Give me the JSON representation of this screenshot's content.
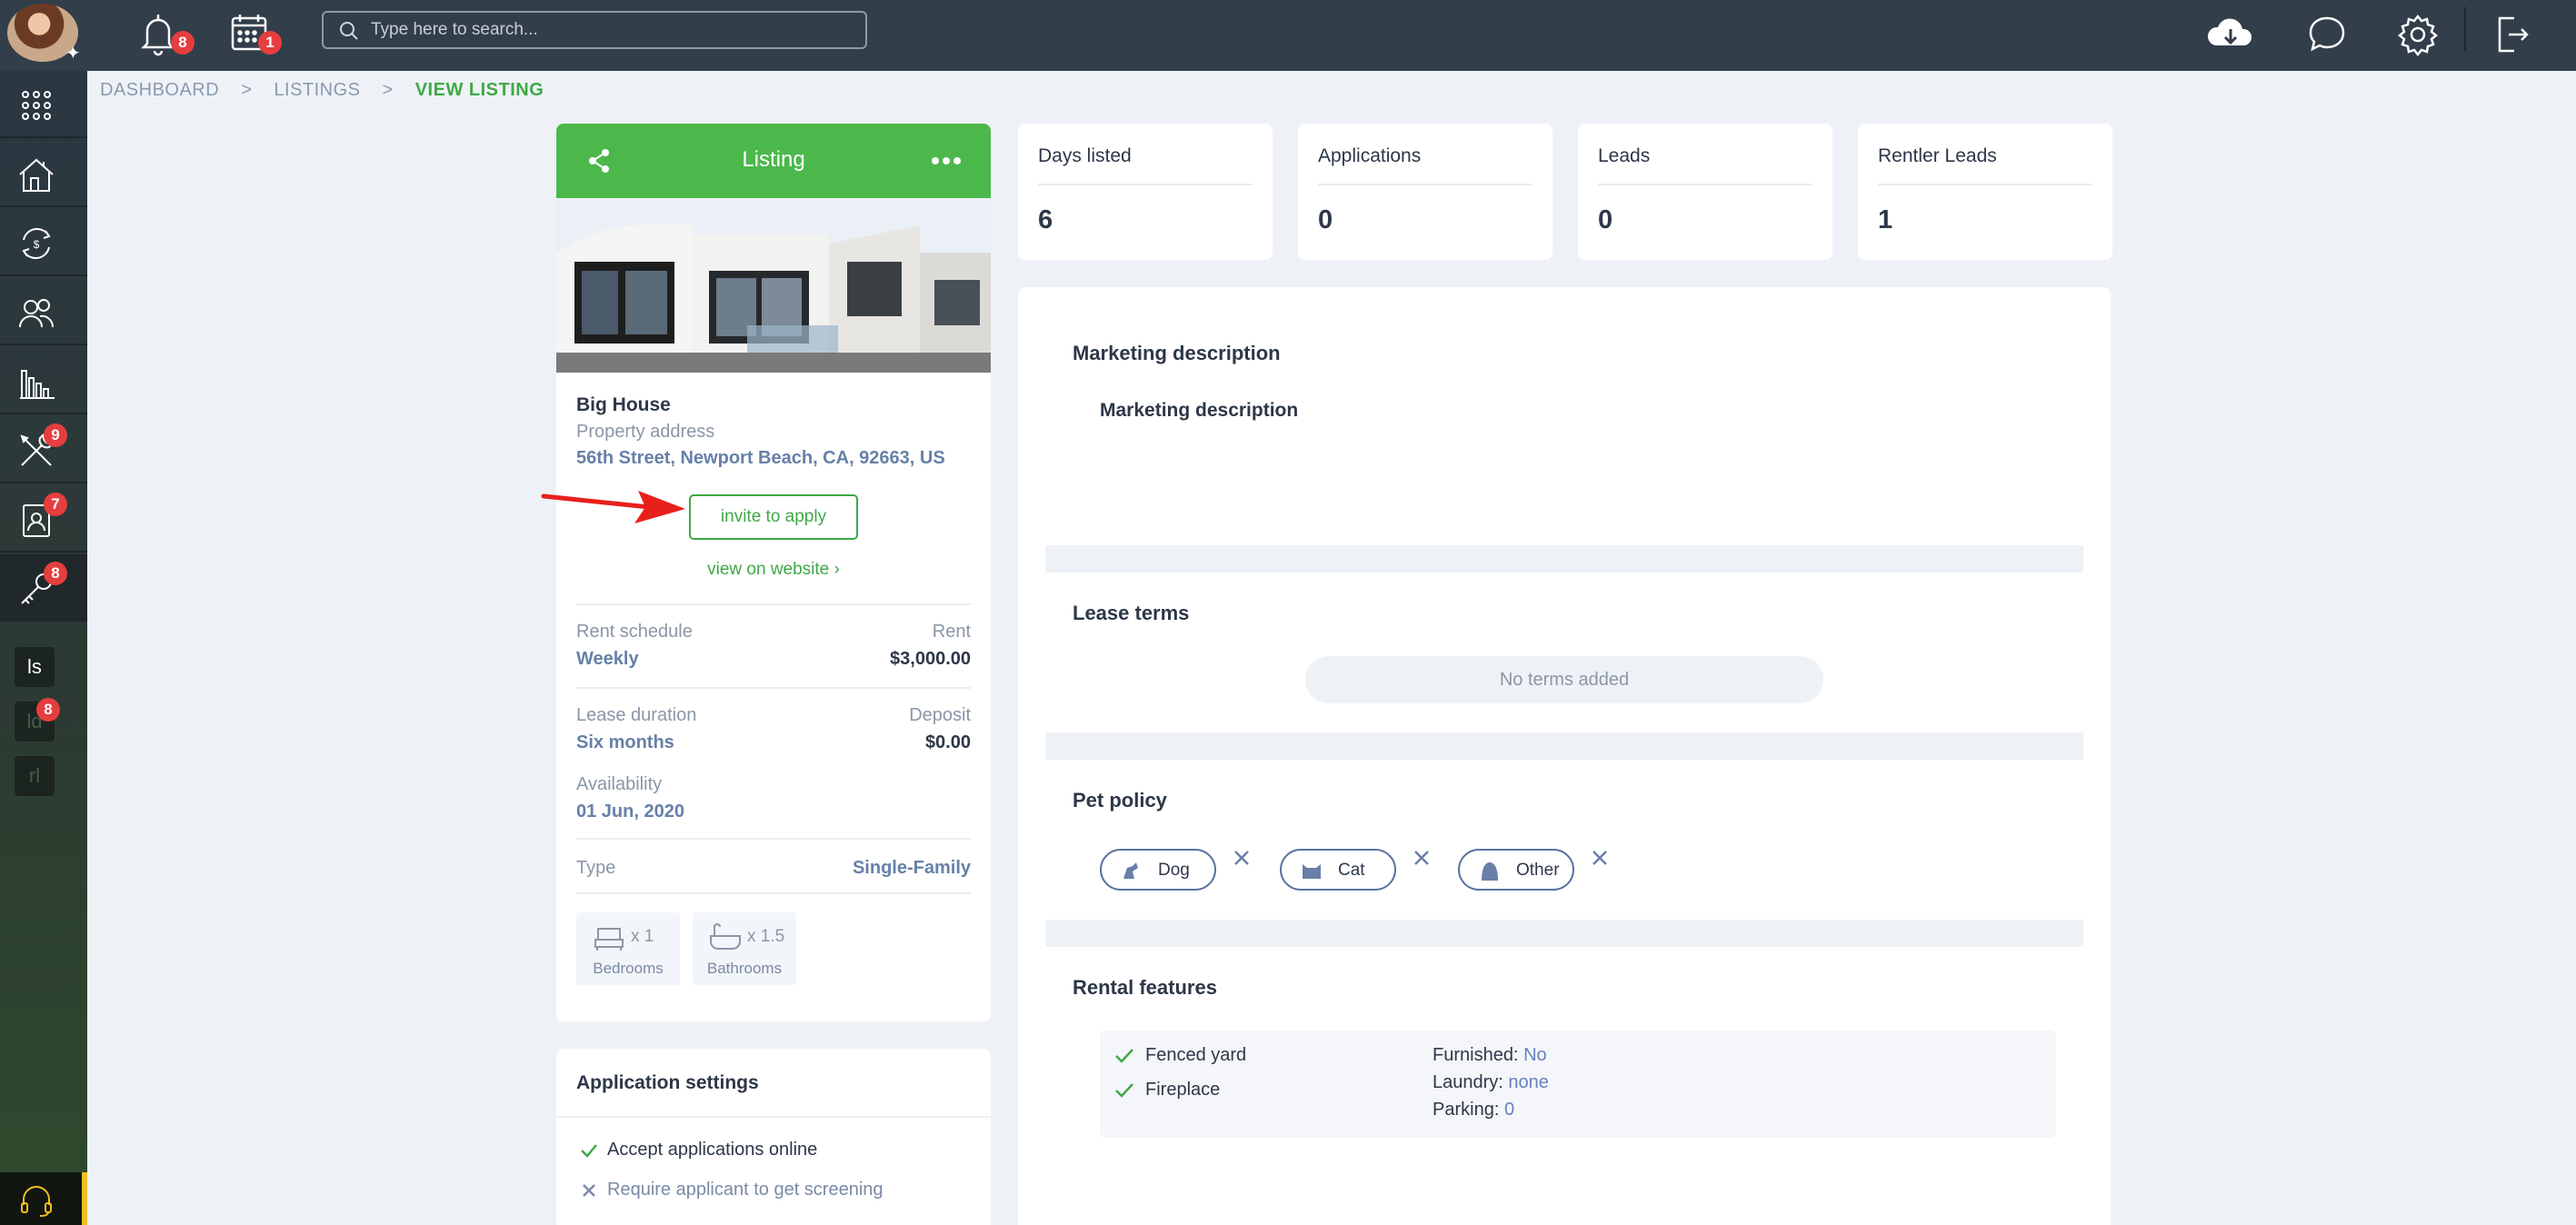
{
  "topbar": {
    "notifications_count": "8",
    "calendar_count": "1",
    "search_placeholder": "Type here to search..."
  },
  "sidebar": {
    "badges": {
      "maintenance": "9",
      "tenants": "7",
      "listings": "8",
      "leads": "8"
    },
    "tags": {
      "ls": "ls",
      "ld": "ld",
      "rl": "rl"
    }
  },
  "breadcrumb": {
    "items": [
      "DASHBOARD",
      "LISTINGS",
      "VIEW LISTING"
    ],
    "separator": ">"
  },
  "listing": {
    "header_title": "Listing",
    "name": "Big House",
    "address_label": "Property address",
    "address": "56th Street, Newport Beach, CA, 92663, US",
    "invite_label": "invite to apply",
    "view_link": "view on website",
    "view_link_chevron": "›",
    "rent_schedule_label": "Rent schedule",
    "rent_schedule": "Weekly",
    "rent_label": "Rent",
    "rent": "$3,000.00",
    "lease_duration_label": "Lease duration",
    "lease_duration": "Six months",
    "deposit_label": "Deposit",
    "deposit": "$0.00",
    "availability_label": "Availability",
    "availability": "01 Jun, 2020",
    "type_label": "Type",
    "type": "Single-Family",
    "bedrooms_count": "x 1",
    "bedrooms_label": "Bedrooms",
    "bathrooms_count": "x 1.5",
    "bathrooms_label": "Bathrooms"
  },
  "app_settings": {
    "title": "Application settings",
    "items": [
      {
        "label": "Accept applications online",
        "enabled": true
      },
      {
        "label": "Require applicant to get screening",
        "enabled": false
      }
    ]
  },
  "stats": [
    {
      "label": "Days listed",
      "value": "6"
    },
    {
      "label": "Applications",
      "value": "0"
    },
    {
      "label": "Leads",
      "value": "0"
    },
    {
      "label": "Rentler Leads",
      "value": "1"
    }
  ],
  "main": {
    "marketing_title": "Marketing description",
    "marketing_subtitle": "Marketing description",
    "lease_terms_title": "Lease terms",
    "no_terms": "No terms added",
    "pet_policy_title": "Pet policy",
    "pets": [
      "Dog",
      "Cat",
      "Other"
    ],
    "rental_features_title": "Rental features",
    "features": [
      "Fenced yard",
      "Fireplace"
    ],
    "details": [
      {
        "key": "Furnished:",
        "value": "No"
      },
      {
        "key": "Laundry:",
        "value": "none"
      },
      {
        "key": "Parking:",
        "value": "0"
      }
    ]
  },
  "colors": {
    "accent_green": "#4cb84c",
    "topbar": "#323e4a",
    "link_blue": "#6680a8",
    "badge_red": "#e53e3e"
  }
}
